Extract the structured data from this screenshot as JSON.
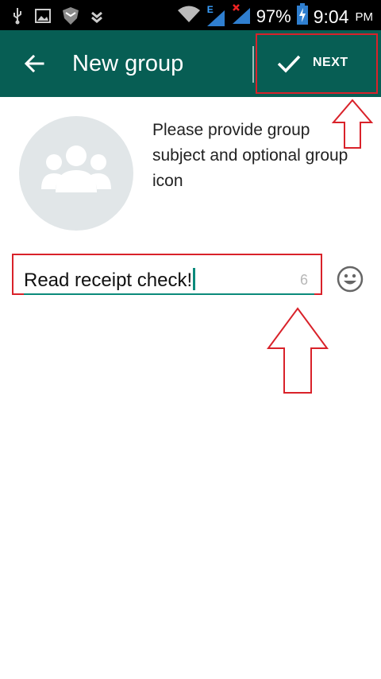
{
  "status_bar": {
    "battery": "97%",
    "time": "9:04",
    "ampm": "PM",
    "network_type": "E",
    "icons": [
      "usb-icon",
      "image-icon",
      "shield-icon",
      "download-icon",
      "wifi-icon",
      "signal-icon",
      "no-signal-icon",
      "battery-icon"
    ]
  },
  "toolbar": {
    "title": "New group",
    "next_label": "NEXT"
  },
  "group_info": {
    "hint": "Please provide group subject and optional group icon"
  },
  "subject_input": {
    "value": "Read receipt check!",
    "counter": "6"
  },
  "colors": {
    "toolbar": "#075e54",
    "accent": "#0b8a7b",
    "annotation": "#d9222a"
  }
}
